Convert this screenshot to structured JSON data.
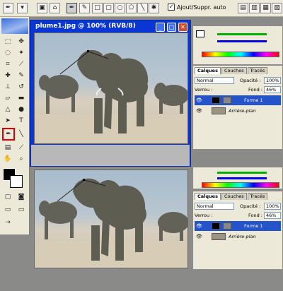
{
  "options_bar": {
    "tool_icon": "pen-icon",
    "autoadd_label": "Ajout/Suppr. auto"
  },
  "document": {
    "title": "plume1.jpg @ 100% (RVB/8)"
  },
  "color_panel": {
    "colors": {
      "r": "#e00000",
      "g": "#00b000",
      "b": "#0000e0"
    }
  },
  "layers_panel": {
    "tabs": [
      "Calques",
      "Couches",
      "Tracés"
    ],
    "blend_mode": "Normal",
    "opacity_label": "Opacité :",
    "opacity_value": "100%",
    "lock_label": "Verrou :",
    "fill_label": "Fond :",
    "fill_value": "46%",
    "layers": [
      {
        "name": "Forme 1",
        "selected": true
      },
      {
        "name": "Arrière-plan",
        "selected": false
      }
    ]
  },
  "colors": {
    "titlebar": "#0a36d6",
    "selected_layer": "#2553c9",
    "highlight_tool": "#e00000",
    "elephant": "#5e5d52"
  }
}
